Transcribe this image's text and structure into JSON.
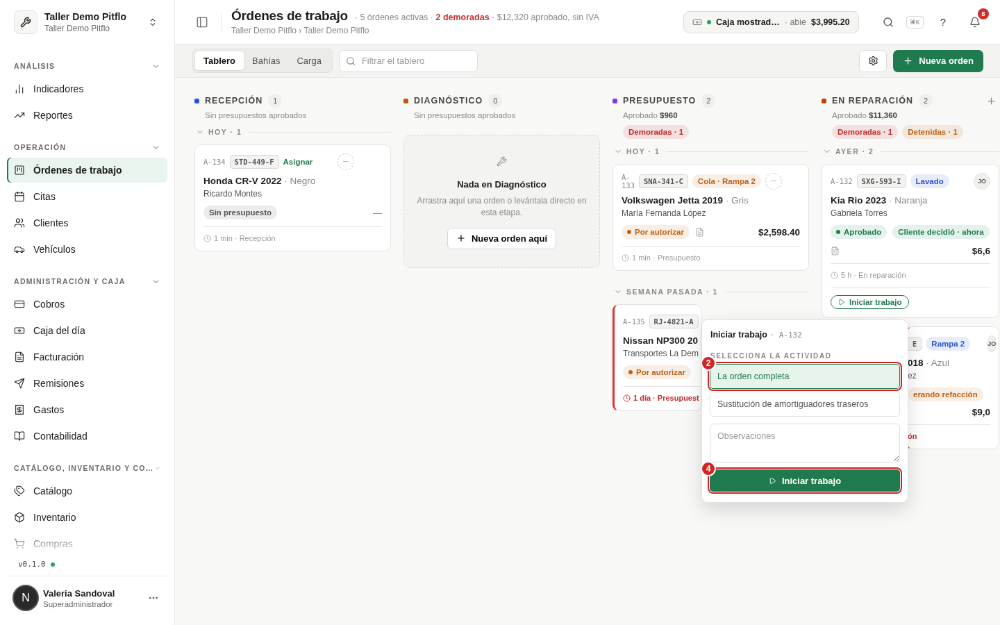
{
  "workspace": {
    "name": "Taller Demo Pitflo",
    "subtitle": "Taller Demo Pitflo"
  },
  "sidebar": {
    "sections": [
      {
        "label": "ANÁLISIS",
        "expanded": true,
        "items": [
          {
            "label": "Indicadores",
            "selected": false
          },
          {
            "label": "Reportes",
            "selected": false
          }
        ]
      },
      {
        "label": "OPERACIÓN",
        "expanded": true,
        "items": [
          {
            "label": "Órdenes de trabajo",
            "selected": true
          },
          {
            "label": "Citas",
            "selected": false
          },
          {
            "label": "Clientes",
            "selected": false
          },
          {
            "label": "Vehículos",
            "selected": false
          }
        ]
      },
      {
        "label": "ADMINISTRACIÓN Y CAJA",
        "expanded": true,
        "items": [
          {
            "label": "Cobros",
            "selected": false
          },
          {
            "label": "Caja del día",
            "selected": false
          },
          {
            "label": "Facturación",
            "selected": false
          },
          {
            "label": "Remisiones",
            "selected": false
          },
          {
            "label": "Gastos",
            "selected": false
          },
          {
            "label": "Contabilidad",
            "selected": false
          }
        ]
      },
      {
        "label": "CATÁLOGO, INVENTARIO Y CO…",
        "expanded": true,
        "items": [
          {
            "label": "Catálogo",
            "selected": false
          },
          {
            "label": "Inventario",
            "selected": false
          },
          {
            "label": "Compras",
            "selected": false
          }
        ]
      }
    ],
    "version": "v0.1.0",
    "version_ok": true,
    "user": {
      "initial": "N",
      "name": "Valeria Sandoval",
      "role": "Superadministrador"
    }
  },
  "header": {
    "title": "Órdenes de trabajo",
    "summary": "· 5 órdenes activas · **2 demoradas** · $12,320 aprobado, sin IVA",
    "breadcrumb": "Taller Demo Pitflo › Taller Demo Pitflo",
    "cash": {
      "register": "Caja mostrad…",
      "open": true,
      "status": "· abie",
      "amount": "$3,995.20"
    },
    "shortcut": "⌘K",
    "help": "?",
    "notifications": "8"
  },
  "toolbar": {
    "tabs": [
      {
        "label": "Tablero",
        "selected": true
      },
      {
        "label": "Bahías",
        "selected": false
      },
      {
        "label": "Carga",
        "selected": false
      }
    ],
    "filter": {
      "placeholder": "Filtrar el tablero"
    },
    "new_button": "Nueva orden"
  },
  "columns": [
    {
      "title": "RECEPCIÓN",
      "color": "#2456d6",
      "count": "1",
      "subtitle": "Sin presupuestos aprobados",
      "addable": false,
      "groups": [
        {
          "label": "HOY · 1",
          "expanded": true,
          "cards": [
            {
              "kind": "full",
              "id": "A-134",
              "plate": "STD-449-F",
              "assign": "Asignar",
              "title": "Honda CR-V 2022",
              "vehicle_color": "· Negro",
              "owner": "Ricardo Montes",
              "status": {
                "label": "Sin presupuesto",
                "color": "#555555",
                "dot": false
              },
              "document": false,
              "amount": "—",
              "footer": "1 min · Recepción",
              "late": false
            }
          ]
        }
      ]
    },
    {
      "title": "DIAGNÓSTICO",
      "color": "#c0560f",
      "count": "0",
      "subtitle": "Sin presupuestos aprobados",
      "addable": false,
      "empty": {
        "title": "Nada en Diagnóstico",
        "text": "Arrastra aquí una orden o levántala directo en esta etapa.",
        "button": "Nueva orden aquí"
      }
    },
    {
      "title": "PRESUPUESTO",
      "color": "#7c3aed",
      "count": "2",
      "subtitle": "Aprobado **$960**",
      "tags": [
        {
          "label": "Demoradas · 1",
          "color": "#c42b2b"
        }
      ],
      "addable": false,
      "groups": [
        {
          "label": "HOY · 1",
          "expanded": true,
          "cards": [
            {
              "kind": "full",
              "id": "A-133",
              "plate": "SNA-341-C",
              "tags": [
                {
                  "label": "Cola · Rampa 2",
                  "color": "#c2610f"
                }
              ],
              "title": "Volkswagen Jetta 2019",
              "vehicle_color": "· Gris",
              "owner": "María Fernanda López",
              "status": {
                "label": "Por autorizar",
                "color": "#c2610f",
                "dot": true
              },
              "document": true,
              "amount": "$2,598.40",
              "footer": "1 min · Presupuesto",
              "late": false
            }
          ]
        },
        {
          "label": "SEMANA PASADA · 1",
          "expanded": true,
          "cards": [
            {
              "kind": "covered_right",
              "id": "A-135",
              "plate": "RJ-4821-A",
              "title": "Nissan NP300 20",
              "owner": "Transportes La Dem",
              "status": {
                "label": "Por autorizar",
                "color": "#c2610f",
                "dot": true
              },
              "footer": "1 día · Presupuest",
              "late": true
            }
          ]
        }
      ]
    },
    {
      "title": "EN REPARACIÓN",
      "color": "#c2410c",
      "count": "2",
      "subtitle": "Aprobado **$11,360**",
      "tags": [
        {
          "label": "Demoradas · 1",
          "color": "#c42b2b"
        },
        {
          "label": "Detenidas · 1",
          "color": "#c2610f"
        }
      ],
      "addable": true,
      "groups": [
        {
          "label": "AYER · 2",
          "expanded": true,
          "cards": [
            {
              "kind": "full",
              "id": "A-132",
              "plate": "SXG-593-I",
              "tags": [
                {
                  "label": "Lavado",
                  "color": "#2a55d0"
                }
              ],
              "assignee": "JO",
              "title": "Kia Rio 2023",
              "vehicle_color": "· Naranja",
              "owner": "Gabriela Torres",
              "status": {
                "label": "Aprobado",
                "color": "#1c7f4d",
                "dot": true
              },
              "extra_tags": [
                {
                  "label": "Cliente decidió · ahora",
                  "color": "#1c7f4d"
                }
              ],
              "document": true,
              "amount": "$6,6",
              "footer": "5 h · En reparación",
              "late": false,
              "action": "Iniciar trabajo"
            },
            {
              "kind": "covered_left",
              "plate": "E",
              "tags": [
                {
                  "label": "Rampa 2",
                  "color": "#2a55d0"
                }
              ],
              "assignee": "JO",
              "title": "018",
              "vehicle_color": "· Azul",
              "owner": "ez",
              "status": {
                "label": "erando refacción",
                "color": "#c2610f",
                "dot": false
              },
              "amount": "$9,0",
              "footer": "ón",
              "late": true
            }
          ]
        }
      ]
    }
  ],
  "popover": {
    "title": "Iniciar trabajo",
    "order": "· A-132",
    "section": "SELECCIONA LA ACTIVIDAD",
    "options": [
      {
        "label": "La orden completa",
        "selected": true,
        "step": "2"
      },
      {
        "label": "Sustitución de amortiguadores traseros",
        "selected": false
      }
    ],
    "notes": {
      "placeholder": "Observaciones"
    },
    "button": {
      "label": "Iniciar trabajo",
      "step": "4"
    }
  }
}
